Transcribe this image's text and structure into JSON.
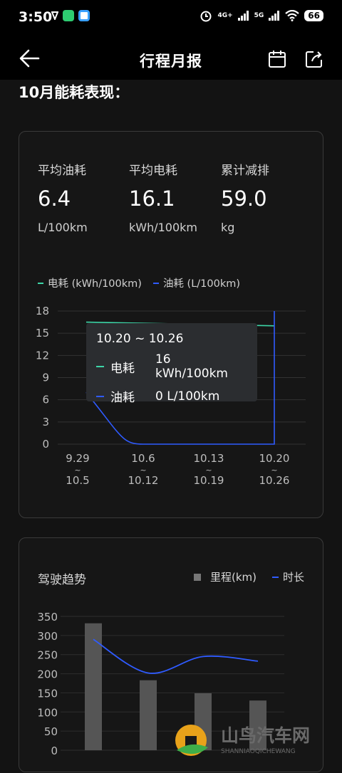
{
  "status_bar": {
    "time": "3:50",
    "network_1": "4G+",
    "network_2": "5G",
    "battery": "66",
    "icon_names": [
      "vpn-icon",
      "wechat-icon",
      "chat-app-icon",
      "alarm-icon",
      "signal-icon",
      "wifi-icon",
      "battery-icon"
    ]
  },
  "header": {
    "title": "行程月报",
    "icons": [
      "back-arrow-icon",
      "calendar-icon",
      "share-icon"
    ]
  },
  "section_title": "10月能耗表现：",
  "stats": [
    {
      "label": "平均油耗",
      "value": "6.4",
      "unit": "L/100km"
    },
    {
      "label": "平均电耗",
      "value": "16.1",
      "unit": "kWh/100km"
    },
    {
      "label": "累计减排",
      "value": "59.0",
      "unit": "kg"
    }
  ],
  "energy_legend": {
    "electric": "电耗 (kWh/100km)",
    "fuel": "油耗 (L/100km)"
  },
  "tooltip": {
    "range": "10.20 ~ 10.26",
    "electric_label": "电耗",
    "electric_value": "16 kWh/100km",
    "fuel_label": "油耗",
    "fuel_value": "0 L/100km"
  },
  "driving": {
    "title": "驾驶趋势",
    "legend_mileage": "里程(km)",
    "legend_duration": "时长"
  },
  "watermark": {
    "text": "山鸟汽车网",
    "subtext": "SHANNIAOQICHEWANG"
  },
  "colors": {
    "electric": "#3dd6a8",
    "fuel": "#2f5bff",
    "bar": "#555555",
    "background": "#131313",
    "card": "#161616"
  },
  "chart_data": [
    {
      "type": "line",
      "ylim": [
        0,
        18
      ],
      "yticks": [
        0,
        3,
        6,
        9,
        12,
        15,
        18
      ],
      "categories": [
        "9.29\n~\n10.5",
        "10.6\n~\n10.12",
        "10.13\n~\n10.19",
        "10.20\n~\n10.26"
      ],
      "grid": true,
      "legend_position": "top-left",
      "series": [
        {
          "name": "电耗 (kWh/100km)",
          "values": [
            16.5,
            16.2,
            16.1,
            16.0
          ]
        },
        {
          "name": "油耗 (L/100km)",
          "values": [
            6.4,
            0,
            0,
            0
          ]
        }
      ]
    },
    {
      "type": "bar",
      "ylim": [
        0,
        350
      ],
      "yticks": [
        0,
        50,
        100,
        150,
        200,
        250,
        300,
        350
      ],
      "grid": true,
      "legend_position": "top-right",
      "series": [
        {
          "name": "里程(km)",
          "type": "bar",
          "values": [
            332,
            183,
            149,
            130
          ]
        },
        {
          "name": "时长",
          "type": "line",
          "values": [
            290,
            202,
            245,
            233
          ]
        }
      ]
    }
  ]
}
